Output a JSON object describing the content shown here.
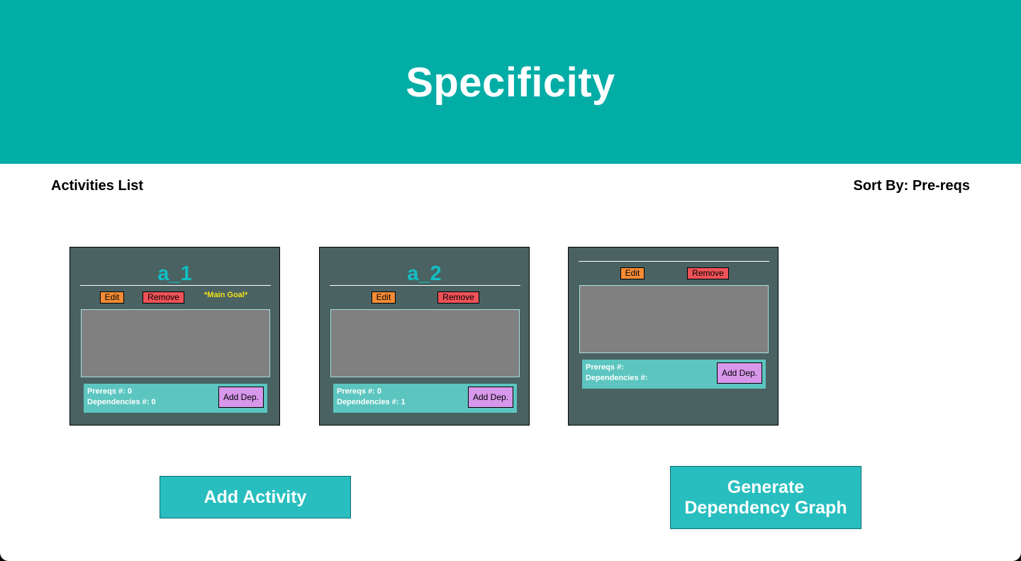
{
  "header": {
    "title": "Specificity"
  },
  "list": {
    "heading": "Activities List",
    "sort_label": "Sort By: Pre-reqs"
  },
  "cards": [
    {
      "name": "a_1",
      "edit_label": "Edit",
      "remove_label": "Remove",
      "main_goal": "*Main Goal*",
      "prereqs": "Prereqs #: 0",
      "dependencies": "Dependencies #: 0",
      "add_dep_label": "Add Dep."
    },
    {
      "name": "a_2",
      "edit_label": "Edit",
      "remove_label": "Remove",
      "main_goal": "",
      "prereqs": "Prereqs #: 0",
      "dependencies": "Dependencies #: 1",
      "add_dep_label": "Add Dep."
    },
    {
      "name": "",
      "edit_label": "Edit",
      "remove_label": "Remove",
      "main_goal": "",
      "prereqs": "Prereqs #:",
      "dependencies": "Dependencies #:",
      "add_dep_label": "Add Dep."
    }
  ],
  "actions": {
    "add_activity": "Add Activity",
    "generate_line1": "Generate",
    "generate_line2": "Dependency Graph"
  },
  "colors": {
    "banner": "#02ada6",
    "card_bg": "#4a6262",
    "card_title": "#10bfc4",
    "edit": "#f78c35",
    "remove": "#ef5258",
    "add_dep": "#d797ea",
    "footer": "#5cc5bf",
    "main_goal": "#f2e318",
    "action_button": "#28bebf"
  }
}
